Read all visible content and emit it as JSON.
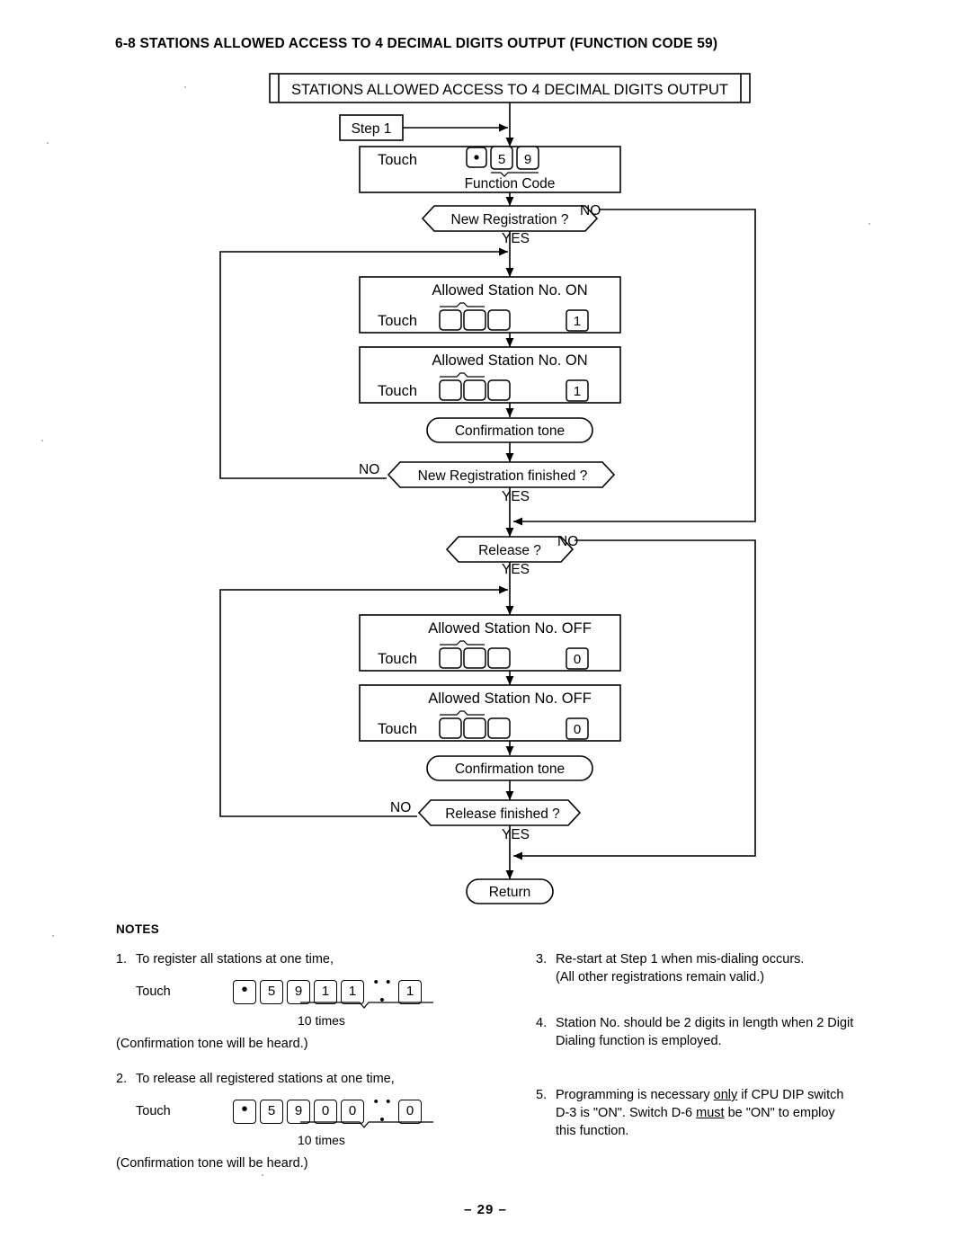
{
  "document": {
    "section_heading": "6-8  STATIONS ALLOWED ACCESS TO 4 DECIMAL DIGITS OUTPUT  (FUNCTION  CODE  59)",
    "page_number": "–  29 –"
  },
  "flowchart": {
    "terminal_title": "STATIONS ALLOWED ACCESS TO 4 DECIMAL DIGITS OUTPUT",
    "step_label": "Step  1",
    "touch_label": "Touch",
    "function_code_label": "Function  Code",
    "function_code_keys": [
      "•",
      "5",
      "9"
    ],
    "decisions": {
      "new_registration": "New Registration ?",
      "new_registration_finished": "New  Registration  finished  ?",
      "release": "Release  ?",
      "release_finished": "Release  finished  ?"
    },
    "yes_label": "YES",
    "no_label": "NO",
    "confirmation_tone": "Confirmation  tone",
    "return_label": "Return",
    "on_block": {
      "header": "Allowed  Station  No.   ON",
      "touch_label": "Touch",
      "station_keys": [
        "",
        "",
        ""
      ],
      "state_key": "1"
    },
    "off_block": {
      "header": "Allowed  Station  No.  OFF",
      "touch_label": "Touch",
      "station_keys": [
        "",
        "",
        ""
      ],
      "state_key": "0"
    }
  },
  "notes": {
    "title": "NOTES",
    "items": [
      {
        "num": "1.",
        "line1": "To register all stations at one time,",
        "touch_label": "Touch",
        "keys": [
          "•",
          "5",
          "9",
          "1",
          "1"
        ],
        "dots": "• • •",
        "tail_key": "1",
        "times_label": "10 times",
        "line_last": "(Confirmation tone will be heard.)"
      },
      {
        "num": "2.",
        "line1": "To release all registered stations at one time,",
        "touch_label": "Touch",
        "keys": [
          "•",
          "5",
          "9",
          "0",
          "0"
        ],
        "dots": "• • •",
        "tail_key": "0",
        "times_label": "10 times",
        "line_last": "(Confirmation tone will be heard.)"
      },
      {
        "num": "3.",
        "line1": "Re-start at Step 1 when mis-dialing occurs.",
        "line2": "(All other registrations remain valid.)"
      },
      {
        "num": "4.",
        "line1": "Station  No.  should  be 2 digits  in  length  when  2 Digit",
        "line2": "Dialing function is employed."
      },
      {
        "num": "5.",
        "part1": "Programming  is  necessary  ",
        "underline1": "only",
        "part2": "  if CPU  DIP  switch",
        "part3": "D-3 is \"ON\".   Switch  D-6  ",
        "underline2": "must",
        "part4": "  be \"ON\" to employ",
        "part5": "this function."
      }
    ]
  },
  "colors": {
    "ink": "#000000",
    "paper": "#ffffff"
  }
}
